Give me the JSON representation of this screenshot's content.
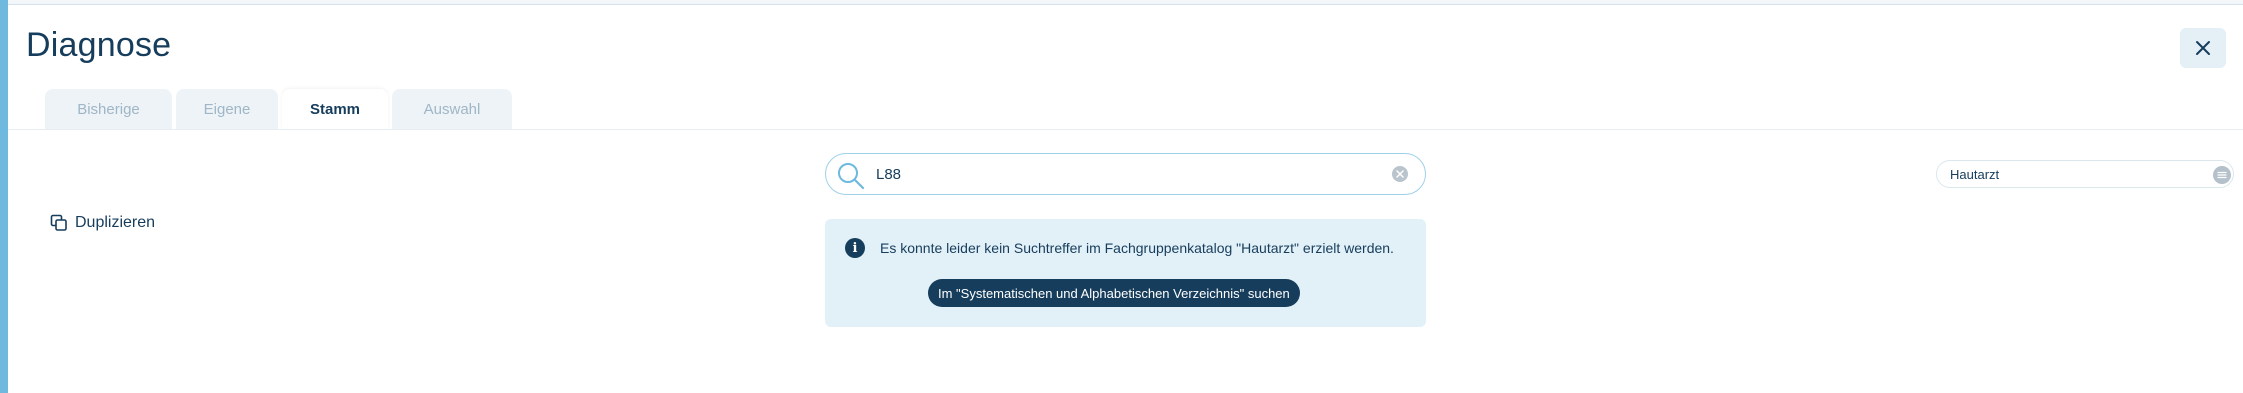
{
  "header": {
    "title": "Diagnose"
  },
  "tabs": [
    {
      "label": "Bisherige",
      "active": false
    },
    {
      "label": "Eigene",
      "active": false
    },
    {
      "label": "Stamm",
      "active": true
    },
    {
      "label": "Auswahl",
      "active": false
    }
  ],
  "sidebar": {
    "duplicate_label": "Duplizieren"
  },
  "search": {
    "value": "L88",
    "placeholder": ""
  },
  "filter": {
    "selected": "Hautarzt"
  },
  "notice": {
    "message": "Es konnte leider kein Suchtreffer im Fachgruppenkatalog \"Hautarzt\" erzielt werden.",
    "action_label": "Im \"Systematischen und Alphabetischen Verzeichnis\" suchen"
  },
  "colors": {
    "primary": "#163d5c",
    "accent": "#6fb8de",
    "notice_bg": "#e2f0f7"
  },
  "icons": [
    "close-icon",
    "search-icon",
    "clear-icon",
    "duplicate-icon",
    "info-icon",
    "list-icon"
  ]
}
